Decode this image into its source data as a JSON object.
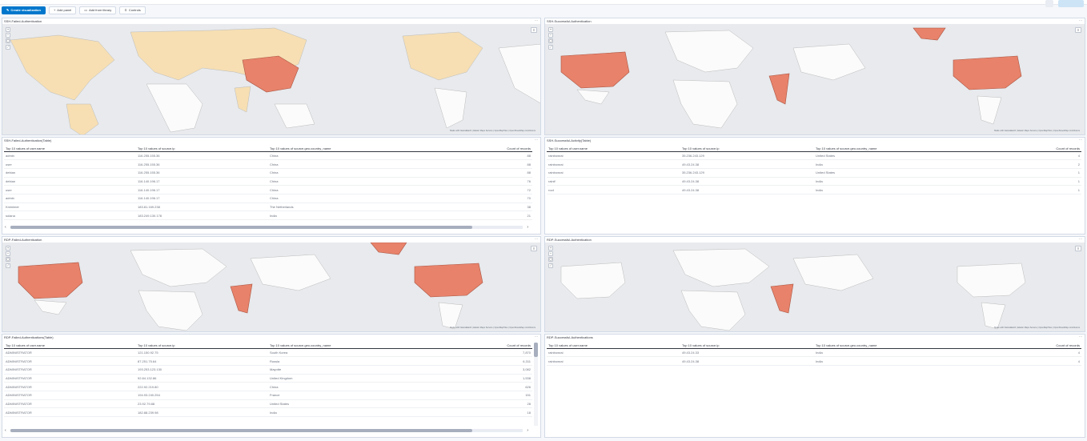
{
  "toolbar": {
    "create": "Create visualization",
    "add_panel": "Add panel",
    "add_library": "Add from library",
    "controls": "Controls",
    "right1": "",
    "right2": ""
  },
  "panels": {
    "p1": {
      "title": "SSH-Failed-Authentication"
    },
    "p2": {
      "title": "SSH-Successful-Authentication"
    },
    "p3": {
      "title": "SSH-Failed-Authentication(Table)"
    },
    "p4": {
      "title": "SSH-Successful-Activity(Table)"
    },
    "p5": {
      "title": "RDP-Failed-Authentication"
    },
    "p6": {
      "title": "RDP-Successful-Authentication"
    },
    "p7": {
      "title": "RDP-Failed-Authentications(Table)"
    },
    "p8": {
      "title": "RDP-Successful-Authentications"
    }
  },
  "map": {
    "attribution": "Made with NaturalEarth | Elastic Maps Service | OpenMapTiles | OpenStreetMap contributors",
    "scale": "1,000 mi",
    "colors": {
      "ocean": "#e8eaed",
      "land": "#fbfbfb",
      "highlight": "#e8826a",
      "light": "#f7dfb3"
    }
  },
  "tables": {
    "headers": [
      "Top 10 values of user.name",
      "Top 10 values of source.ip",
      "Top 10 values of source.geo.country_name",
      "Count of records"
    ],
    "ssh_failed": [
      [
        "admin",
        "116.255.155.36",
        "China",
        "88"
      ],
      [
        "user",
        "116.255.155.36",
        "China",
        "88"
      ],
      [
        "debian",
        "116.255.155.36",
        "China",
        "88"
      ],
      [
        "debian",
        "116.140.196.17",
        "China",
        "76"
      ],
      [
        "user",
        "116.140.196.17",
        "China",
        "72"
      ],
      [
        "admin",
        "116.140.196.17",
        "China",
        "70"
      ],
      [
        "Kminimer",
        "183.81.169.238",
        "The Netherlands",
        "38"
      ],
      [
        "solana",
        "183.249.130.178",
        "India",
        "21"
      ]
    ],
    "ssh_success": [
      [
        "rainbowrai",
        "35.236.243.129",
        "United States",
        "4"
      ],
      [
        "rainbowrai",
        "49.43.24.38",
        "India",
        "2"
      ],
      [
        "rainbowrai",
        "35.236.243.129",
        "United States",
        "1"
      ],
      [
        "rainif",
        "49.43.24.38",
        "India",
        "1"
      ],
      [
        "root",
        "49.43.24.38",
        "India",
        "1"
      ]
    ],
    "rdp_failed": [
      [
        "ADMINISTRATOR",
        "121.150.92.75",
        "South Korea",
        "7,870"
      ],
      [
        "ADMINISTRATOR",
        "87.251.75.64",
        "Russia",
        "6,311"
      ],
      [
        "ADMINISTRATOR",
        "193.253.123.130",
        "Mayotte",
        "3,082"
      ],
      [
        "ADMINISTRATOR",
        "92.84.132.86",
        "United Kingdom",
        "1,538"
      ],
      [
        "ADMINISTRATOR",
        "222.92.219.80",
        "China",
        "626"
      ],
      [
        "ADMINISTRATOR",
        "194.93.240.254",
        "France",
        "151"
      ],
      [
        "ADMINISTRATOR",
        "23.92.79.88",
        "United States",
        "28"
      ],
      [
        "ADMINISTRATOR",
        "182.88.239.98",
        "India",
        "18"
      ]
    ],
    "rdp_success": [
      [
        "rainbowrai",
        "49.43.24.33",
        "India",
        "4"
      ],
      [
        "rainbowrai",
        "49.43.24.38",
        "India",
        "4"
      ]
    ]
  }
}
